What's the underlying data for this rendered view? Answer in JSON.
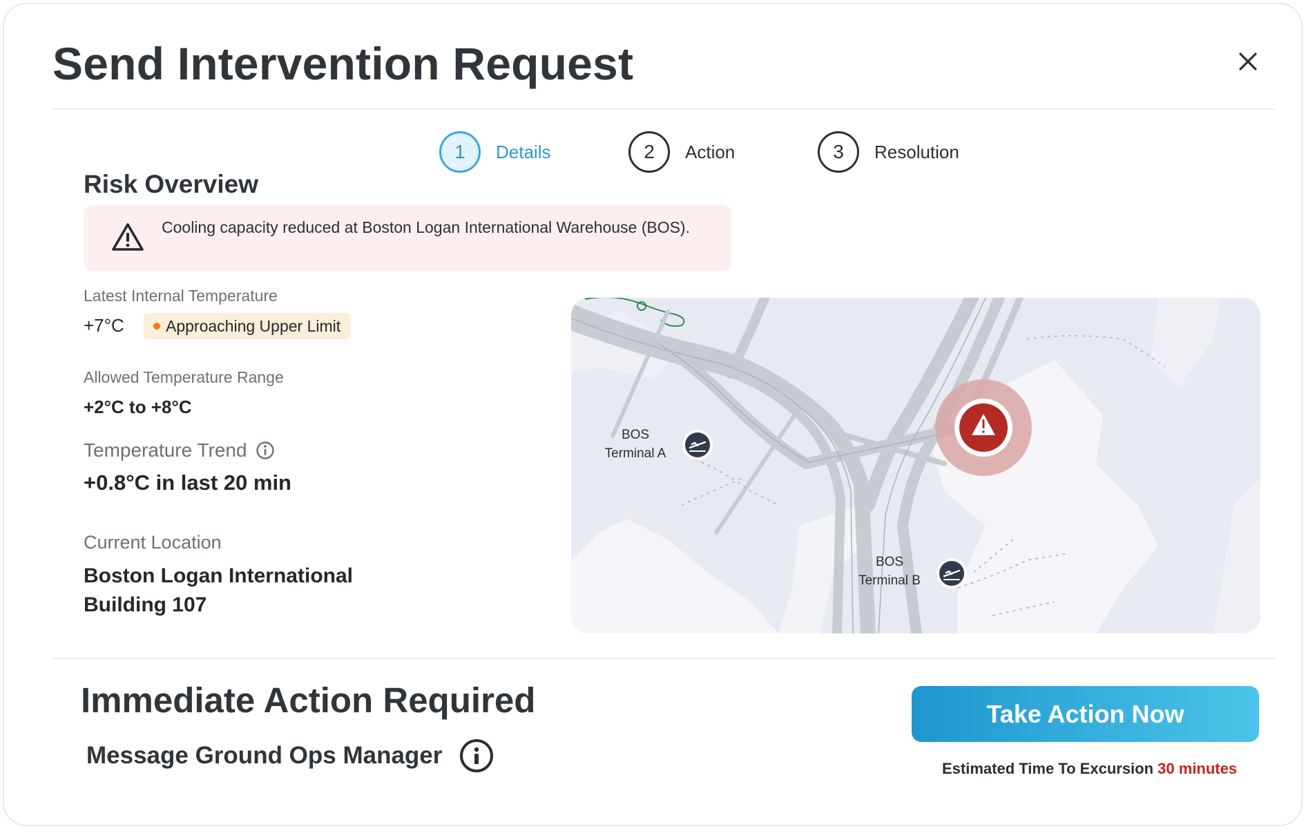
{
  "dialog": {
    "title": "Send Intervention Request",
    "close_icon": "close-icon"
  },
  "stepper": {
    "steps": [
      {
        "number": "1",
        "label": "Details",
        "active": true
      },
      {
        "number": "2",
        "label": "Action",
        "active": false
      },
      {
        "number": "3",
        "label": "Resolution",
        "active": false
      }
    ]
  },
  "risk": {
    "title": "Risk Overview",
    "alert": {
      "icon": "warning-triangle-icon",
      "text": "Cooling capacity reduced at Boston Logan International Warehouse (BOS)."
    },
    "latest_temp_label": "Latest Internal Temperature",
    "latest_temp_value": "+7°C",
    "latest_temp_badge": "Approaching Upper Limit",
    "allowed_range_label": "Allowed Temperature Range",
    "allowed_range_value": "+2°C to +8°C",
    "trend_label": "Temperature Trend",
    "trend_value": "+0.8°C in last 20 min",
    "location_label": "Current Location",
    "location_line1": "Boston Logan International",
    "location_line2": "Building 107"
  },
  "map": {
    "markers": [
      {
        "code": "BOS",
        "name": "Terminal A",
        "icon": "airplane-departure-icon"
      },
      {
        "code": "BOS",
        "name": "Terminal B",
        "icon": "airplane-departure-icon"
      }
    ],
    "risk_marker_icon": "warning-triangle-icon"
  },
  "action": {
    "title": "Immediate Action Required",
    "message_label": "Message Ground Ops Manager",
    "button_label": "Take Action Now",
    "eta_label": "Estimated Time To Excursion",
    "eta_value": "30 minutes"
  },
  "colors": {
    "accent": "#2f97cc",
    "alert_bg": "#fdeff0",
    "badge_bg": "#fdeed9",
    "badge_dot": "#f07a1f",
    "danger": "#c8221f"
  }
}
